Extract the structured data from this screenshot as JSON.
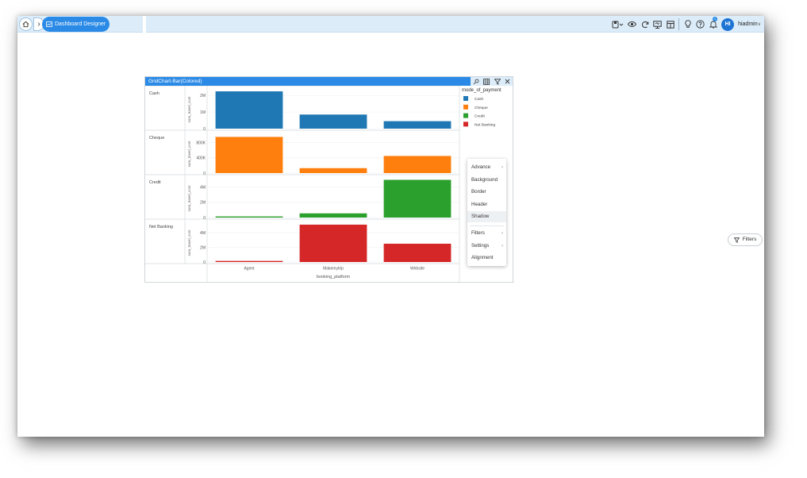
{
  "topbar": {
    "breadcrumb_active": "Dashboard Designer",
    "user_initials": "HI",
    "username": "hiadmin",
    "notification_count": "1"
  },
  "icons": {
    "home": "home-icon",
    "breadcrumb_chevron": "chevron-right-icon",
    "designer": "dashboard-designer-icon",
    "toolbar": [
      "save-icon",
      "preview-eye-icon",
      "refresh-icon",
      "present-icon",
      "layout-icon",
      "bulb-icon",
      "help-icon",
      "bell-icon"
    ]
  },
  "widget": {
    "title": "GridChart-Bar(Colored)",
    "actions": [
      "pin-icon",
      "grid-icon",
      "filter-icon",
      "close-icon"
    ]
  },
  "chart_data": {
    "type": "bar",
    "grid": true,
    "xlabel": "booking_platform",
    "categories": [
      "Agent",
      "Makemytrip",
      "Website"
    ],
    "row_ylabel": "sum_travel_cost",
    "legend": {
      "title": "mode_of_payment",
      "placement": "right",
      "entries": [
        {
          "name": "Cash",
          "color": "#1f77b4"
        },
        {
          "name": "Cheque",
          "color": "#ff7f0e"
        },
        {
          "name": "Credit",
          "color": "#2ca02c"
        },
        {
          "name": "Net Banking",
          "color": "#d62728"
        }
      ]
    },
    "rows": [
      {
        "name": "Cash",
        "color": "#1f77b4",
        "ylim": [
          0,
          2300000
        ],
        "ticks": [
          {
            "v": 0,
            "label": "0"
          },
          {
            "v": 1000000,
            "label": "1M"
          },
          {
            "v": 2000000,
            "label": "2M"
          }
        ],
        "values": [
          2250000,
          850000,
          450000
        ]
      },
      {
        "name": "Cheque",
        "color": "#ff7f0e",
        "ylim": [
          0,
          1000000
        ],
        "ticks": [
          {
            "v": 0,
            "label": "0"
          },
          {
            "v": 400000,
            "label": "400K"
          },
          {
            "v": 800000,
            "label": "800K"
          }
        ],
        "values": [
          950000,
          130000,
          450000
        ]
      },
      {
        "name": "Credit",
        "color": "#2ca02c",
        "ylim": [
          0,
          5000000
        ],
        "ticks": [
          {
            "v": 0,
            "label": "0"
          },
          {
            "v": 2000000,
            "label": "2M"
          },
          {
            "v": 4000000,
            "label": "4M"
          }
        ],
        "values": [
          150000,
          550000,
          4950000
        ]
      },
      {
        "name": "Net Banking",
        "color": "#d62728",
        "ylim": [
          0,
          5200000
        ],
        "ticks": [
          {
            "v": 0,
            "label": "0"
          },
          {
            "v": 2000000,
            "label": "2M"
          },
          {
            "v": 4000000,
            "label": "4M"
          }
        ],
        "values": [
          150000,
          5100000,
          2500000
        ]
      }
    ]
  },
  "context_menu": {
    "items": [
      {
        "label": "Advance",
        "submenu": true
      },
      {
        "label": "Background",
        "submenu": false
      },
      {
        "label": "Border",
        "submenu": false
      },
      {
        "label": "Header",
        "submenu": false
      },
      {
        "label": "Shadow",
        "submenu": false,
        "highlighted": true
      },
      {
        "label": "Filters",
        "submenu": true
      },
      {
        "label": "Settings",
        "submenu": true
      },
      {
        "label": "Alignment",
        "submenu": false
      }
    ]
  },
  "filters_button": {
    "label": "Filters"
  }
}
